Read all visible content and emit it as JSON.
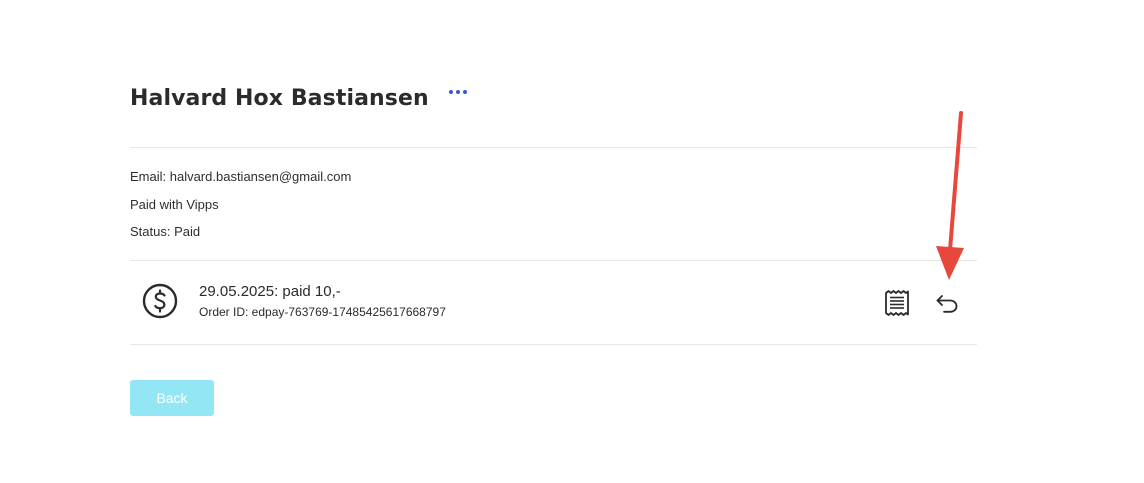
{
  "customer": {
    "name": "Halvard Hox Bastiansen"
  },
  "details": {
    "email": "Email: halvard.bastiansen@gmail.com",
    "payment_method": "Paid with Vipps",
    "status": "Status: Paid"
  },
  "payment": {
    "title": "29.05.2025: paid 10,-",
    "order_id": "Order ID: edpay-763769-17485425617668797",
    "icon": "dollar-coin-icon"
  },
  "actions": {
    "receipt_icon": "receipt-icon",
    "refund_icon": "undo-arrow-icon",
    "more_icon": "more-dots-icon"
  },
  "buttons": {
    "back_label": "Back"
  },
  "colors": {
    "accent_dots": "#3a55d6",
    "back_button": "#93e6f4",
    "annotation_arrow": "#e8473c"
  }
}
